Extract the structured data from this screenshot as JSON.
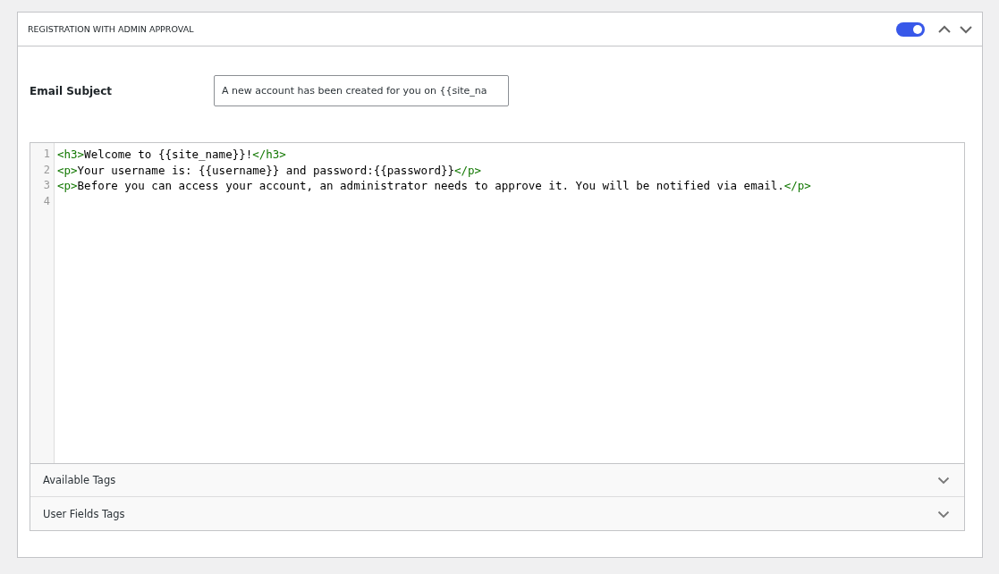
{
  "panel": {
    "title": "REGISTRATION WITH ADMIN APPROVAL",
    "enabled": true
  },
  "subject": {
    "label": "Email Subject",
    "value": "A new account has been created for you on {{site_na"
  },
  "editor": {
    "lines": [
      {
        "number": "1",
        "segments": [
          {
            "kind": "tag",
            "text": "<h3>"
          },
          {
            "kind": "text",
            "text": "Welcome to {{site_name}}!"
          },
          {
            "kind": "tag",
            "text": "</h3>"
          }
        ]
      },
      {
        "number": "2",
        "segments": [
          {
            "kind": "tag",
            "text": "<p>"
          },
          {
            "kind": "text",
            "text": "Your username is: {{username}} and password:{{password}}"
          },
          {
            "kind": "tag",
            "text": "</p>"
          }
        ]
      },
      {
        "number": "3",
        "segments": [
          {
            "kind": "tag",
            "text": "<p>"
          },
          {
            "kind": "text",
            "text": "Before you can access your account, an administrator needs to approve it. You will be notified via email."
          },
          {
            "kind": "tag",
            "text": "</p>"
          }
        ]
      },
      {
        "number": "4"
      }
    ]
  },
  "sections": [
    {
      "label": "Available Tags",
      "expanded": false
    },
    {
      "label": "User Fields Tags",
      "expanded": false
    }
  ]
}
